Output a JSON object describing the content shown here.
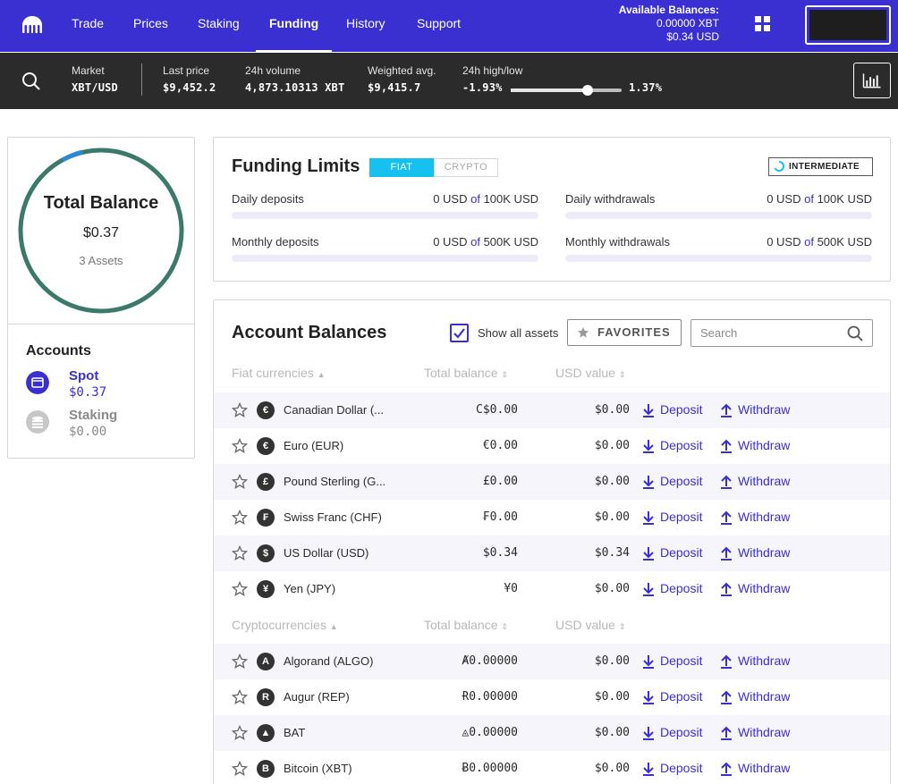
{
  "nav": {
    "items": [
      "Trade",
      "Prices",
      "Staking",
      "Funding",
      "History",
      "Support"
    ],
    "active": "Funding",
    "available_title": "Available Balances:",
    "available_xbt": "0.00000 XBT",
    "available_usd": "$0.34 USD"
  },
  "ticker": {
    "market_label": "Market",
    "market_value": "XBT/USD",
    "last_label": "Last price",
    "last_value": "$9,452.2",
    "vol_label": "24h volume",
    "vol_value": "4,873.10313 XBT",
    "wavg_label": "Weighted avg.",
    "wavg_value": "$9,415.7",
    "hl_label": "24h high/low",
    "low_value": "-1.93%",
    "high_value": "1.37%",
    "hl_position": 0.69
  },
  "total": {
    "title": "Total Balance",
    "amount": "$0.37",
    "assets": "3 Assets",
    "ring_main_color": "#3b7a6a",
    "ring_accent_color": "#2a8ad8"
  },
  "accounts": {
    "heading": "Accounts",
    "items": [
      {
        "name": "Spot",
        "value": "$0.37"
      },
      {
        "name": "Staking",
        "value": "$0.00"
      }
    ]
  },
  "limits": {
    "title": "Funding Limits",
    "tab_fiat": "FIAT",
    "tab_crypto": "CRYPTO",
    "badge": "INTERMEDIATE",
    "of": "of",
    "rows": [
      {
        "name": "Daily deposits",
        "used": "0 USD",
        "limit": "100K USD"
      },
      {
        "name": "Daily withdrawals",
        "used": "0 USD",
        "limit": "100K USD"
      },
      {
        "name": "Monthly deposits",
        "used": "0 USD",
        "limit": "500K USD"
      },
      {
        "name": "Monthly withdrawals",
        "used": "0 USD",
        "limit": "500K USD"
      }
    ]
  },
  "balances": {
    "title": "Account Balances",
    "show_all": "Show all assets",
    "favorites": "FAVORITES",
    "search_placeholder": "Search",
    "col_total": "Total balance",
    "col_usd": "USD value",
    "deposit": "Deposit",
    "withdraw": "Withdraw",
    "fiat_header": "Fiat currencies",
    "fiat": [
      {
        "icon": "€",
        "name": "Canadian Dollar (...",
        "total": "C$0.00",
        "usd": "$0.00"
      },
      {
        "icon": "€",
        "name": "Euro (EUR)",
        "total": "€0.00",
        "usd": "$0.00"
      },
      {
        "icon": "£",
        "name": "Pound Sterling (G...",
        "total": "£0.00",
        "usd": "$0.00"
      },
      {
        "icon": "₣",
        "name": "Swiss Franc (CHF)",
        "total": "₣0.00",
        "usd": "$0.00"
      },
      {
        "icon": "$",
        "name": "US Dollar (USD)",
        "total": "$0.34",
        "usd": "$0.34"
      },
      {
        "icon": "¥",
        "name": "Yen (JPY)",
        "total": "¥0",
        "usd": "$0.00"
      }
    ],
    "crypto_header": "Cryptocurrencies",
    "crypto": [
      {
        "icon": "A",
        "name": "Algorand (ALGO)",
        "total": "Ⱥ0.00000",
        "usd": "$0.00"
      },
      {
        "icon": "R",
        "name": "Augur (REP)",
        "total": "Ɍ0.00000",
        "usd": "$0.00"
      },
      {
        "icon": "▲",
        "name": "BAT",
        "total": "◬0.00000",
        "usd": "$0.00"
      },
      {
        "icon": "B",
        "name": "Bitcoin (XBT)",
        "total": "Ƀ0.00000",
        "usd": "$0.00"
      }
    ]
  }
}
